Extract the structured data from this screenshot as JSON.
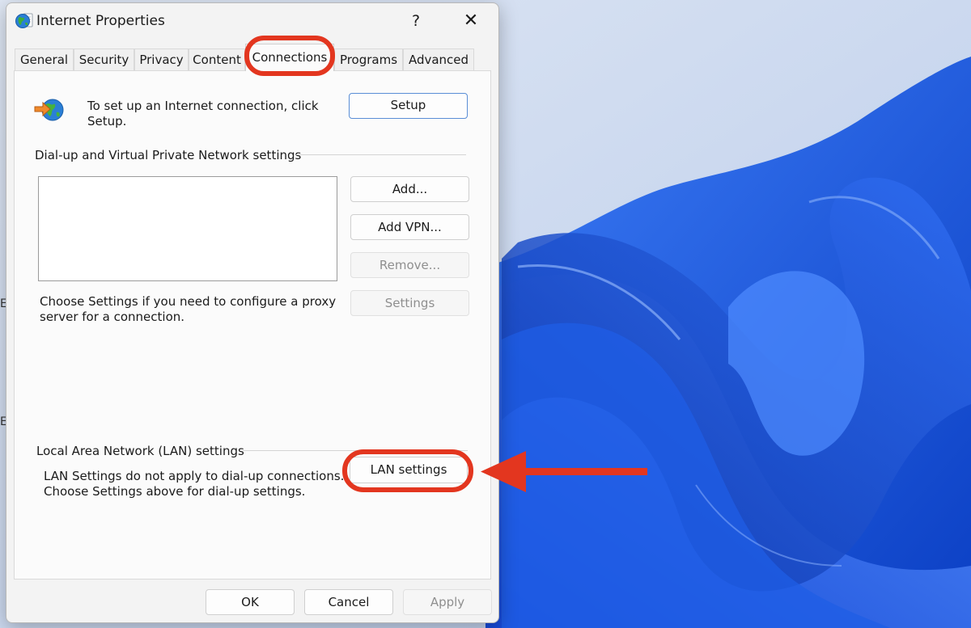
{
  "window": {
    "title": "Internet Properties",
    "help_label": "?",
    "close_label": "✕"
  },
  "tabs": [
    {
      "label": "General"
    },
    {
      "label": "Security"
    },
    {
      "label": "Privacy"
    },
    {
      "label": "Content"
    },
    {
      "label": "Connections",
      "active": true
    },
    {
      "label": "Programs"
    },
    {
      "label": "Advanced"
    }
  ],
  "setup": {
    "text_line1": "To set up an Internet connection, click",
    "text_line2": "Setup.",
    "button_label": "Setup"
  },
  "dialup": {
    "group_title": "Dial-up and Virtual Private Network settings",
    "add_label": "Add...",
    "add_vpn_label": "Add VPN...",
    "remove_label": "Remove...",
    "settings_label": "Settings",
    "hint_line1": "Choose Settings if you need to configure a proxy",
    "hint_line2": "server for a connection."
  },
  "lan": {
    "group_title": "Local Area Network (LAN) settings",
    "note_line1": "LAN Settings do not apply to dial-up connections.",
    "note_line2": "Choose Settings above for dial-up settings.",
    "button_label": "LAN settings"
  },
  "footer": {
    "ok_label": "OK",
    "cancel_label": "Cancel",
    "apply_label": "Apply"
  },
  "colors": {
    "highlight": "#e3361f",
    "wallpaper_blue": "#1a5be0",
    "accent_border": "#5a8ed6"
  },
  "icons": {
    "app": "globe-icon",
    "setup": "connect-wizard-icon",
    "annotation": "red-arrow-left"
  }
}
